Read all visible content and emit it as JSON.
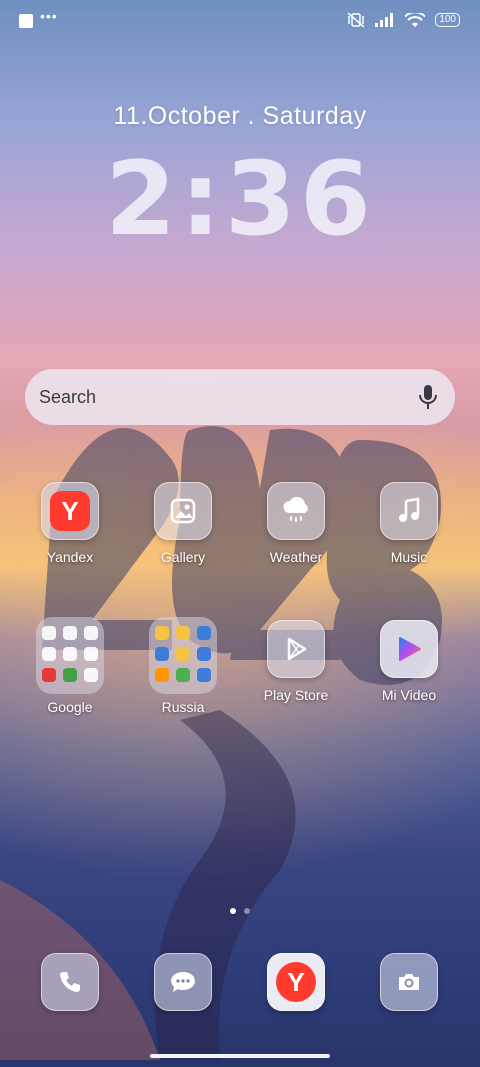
{
  "status_bar": {
    "battery": "100",
    "icons": [
      "app-square-icon",
      "more-dots-icon",
      "vibrate-off-icon",
      "signal-icon",
      "wifi-icon",
      "battery-icon"
    ],
    "dots": "•••"
  },
  "lock": {
    "date": "11.October . Saturday",
    "time": "2:36"
  },
  "search": {
    "placeholder": "Search"
  },
  "apps_row1": [
    {
      "label": "Yandex",
      "icon": "yandex-icon"
    },
    {
      "label": "Gallery",
      "icon": "gallery-icon"
    },
    {
      "label": "Weather",
      "icon": "weather-icon"
    },
    {
      "label": "Music",
      "icon": "music-icon"
    }
  ],
  "apps_row2": [
    {
      "label": "Google",
      "icon": "folder-icon"
    },
    {
      "label": "Russia",
      "icon": "folder-icon"
    },
    {
      "label": "Play Store",
      "icon": "play-store-icon"
    },
    {
      "label": "Mi Video",
      "icon": "mi-video-icon"
    }
  ],
  "dock": [
    {
      "icon": "phone-icon"
    },
    {
      "icon": "messages-icon"
    },
    {
      "icon": "yandex-browser-icon"
    },
    {
      "icon": "camera-icon"
    }
  ],
  "colors": {
    "yandex_red": "#ff3b30",
    "accent": "#ffffff"
  }
}
